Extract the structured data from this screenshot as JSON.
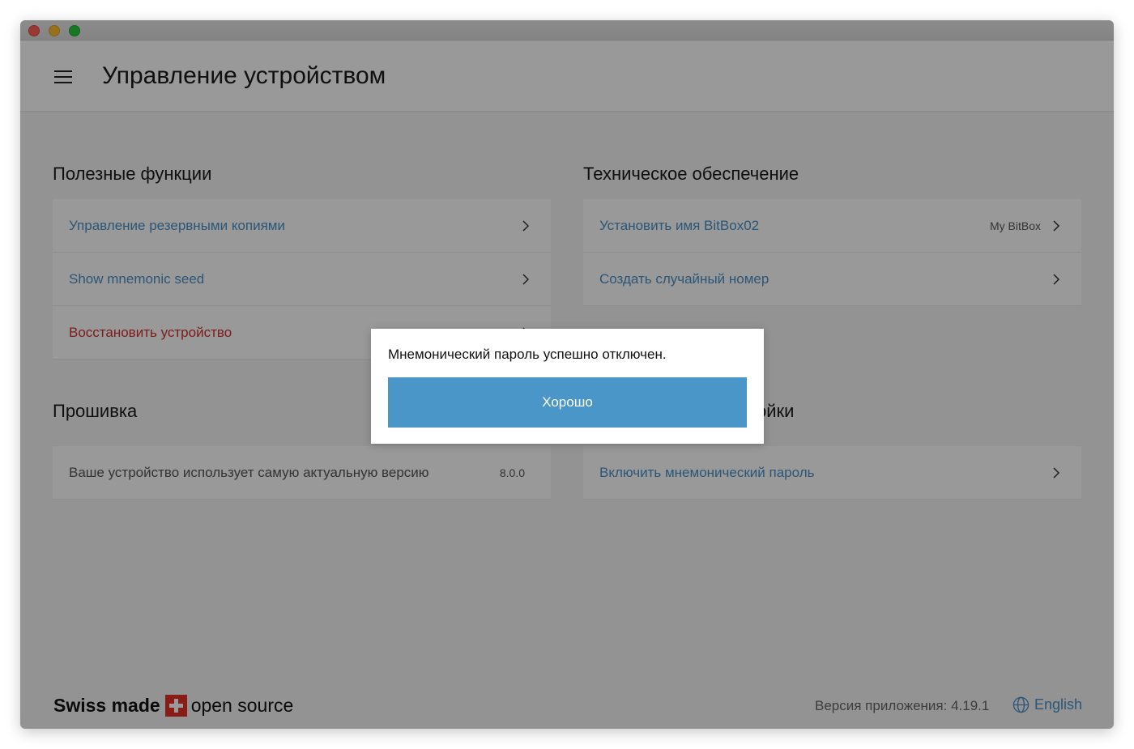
{
  "header": {
    "title": "Управление устройством"
  },
  "sections": {
    "useful": {
      "title": "Полезные функции",
      "items": [
        {
          "label": "Управление резервными копиями"
        },
        {
          "label": "Show mnemonic seed"
        },
        {
          "label": "Восстановить устройство"
        }
      ]
    },
    "hardware": {
      "title": "Техническое обеспечение",
      "items": [
        {
          "label": "Установить имя BitBox02",
          "value": "My BitBox"
        },
        {
          "label": "Создать случайный номер"
        }
      ]
    },
    "firmware": {
      "title": "Прошивка",
      "items": [
        {
          "label": "Ваше устройство использует самую актуальную версию",
          "value": "8.0.0"
        }
      ]
    },
    "expert": {
      "title": "ойки",
      "items": [
        {
          "label": "Включить мнемонический пароль"
        }
      ]
    }
  },
  "footer": {
    "brand_bold": "Swiss made",
    "brand_rest": "open source",
    "version": "Версия приложения: 4.19.1",
    "language": "English"
  },
  "dialog": {
    "message": "Мнемонический пароль успешно отключен.",
    "ok_label": "Хорошо"
  },
  "colors": {
    "accent": "#4a90c8",
    "danger": "#d03030",
    "button": "#4a96c8"
  }
}
